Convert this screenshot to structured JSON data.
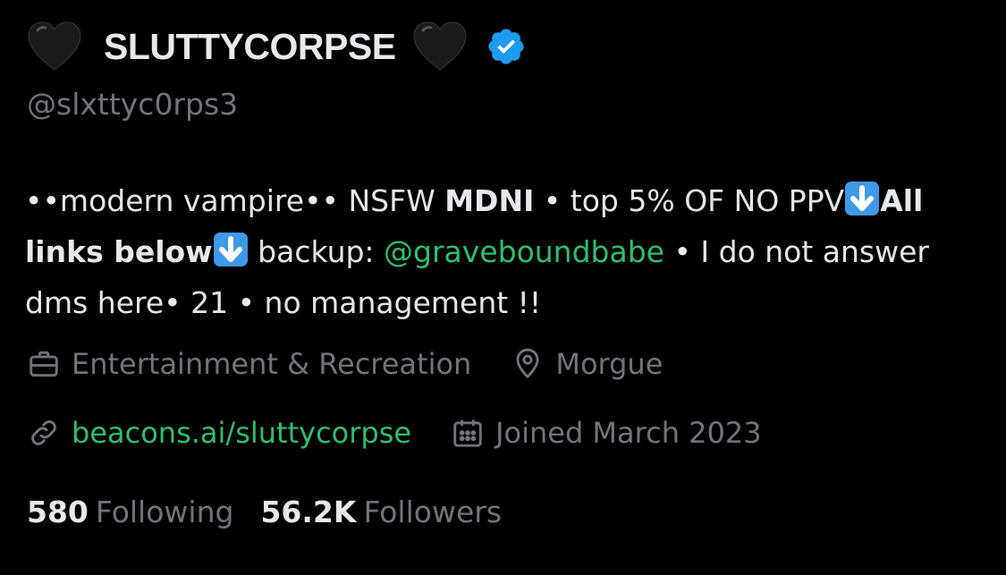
{
  "profile": {
    "display_name": "SLUTTYCORPSE",
    "handle": "@slxttyc0rps3",
    "verified": true,
    "name_emoji": "black-heart-icon",
    "bio": {
      "p1": "••modern vampire•• NSFW ",
      "p2": "MDNI",
      "p3": " • top 5% OF NO PPV",
      "p4": "All links below",
      "p5": " backup: ",
      "mention": "@graveboundbabe",
      "p6": " • I do not answer dms here• 21 • no management !!"
    },
    "category": "Entertainment & Recreation",
    "location": "Morgue",
    "website": "beacons.ai/sluttycorpse",
    "joined": "Joined March 2023",
    "following_count": "580",
    "following_label": "Following",
    "followers_count": "56.2K",
    "followers_label": "Followers"
  },
  "icons": {
    "category": "briefcase-icon",
    "location": "location-pin-icon",
    "website": "link-icon",
    "joined": "calendar-icon",
    "verified": "verified-badge-icon",
    "arrow": "down-arrow-emoji-icon"
  },
  "colors": {
    "background": "#000000",
    "primary_text": "#e7e9ea",
    "secondary_text": "#71767b",
    "link": "#2fbf71",
    "verified_blue": "#1d9bf0"
  }
}
